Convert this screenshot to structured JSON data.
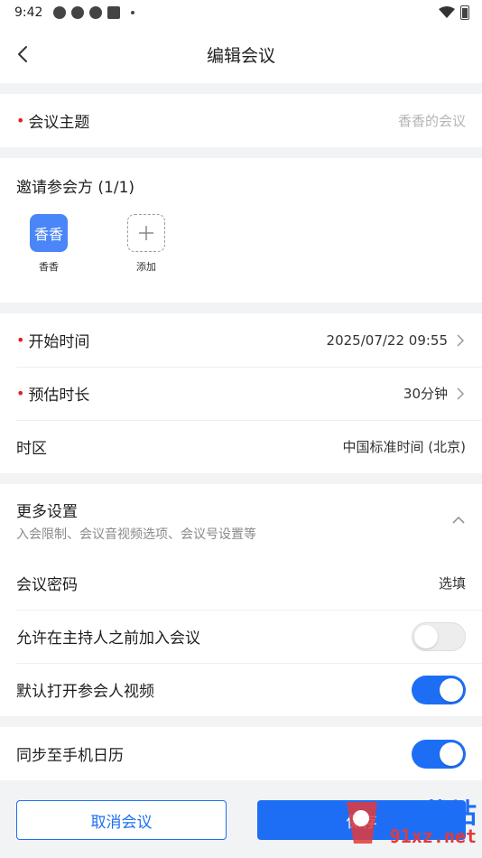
{
  "status_bar": {
    "time": "9:42"
  },
  "header": {
    "title": "编辑会议"
  },
  "topic": {
    "label": "会议主题",
    "placeholder": "香香的会议"
  },
  "invite": {
    "title": "邀请参会方 (1/1)",
    "participants": [
      {
        "avatar_text": "香香",
        "name": "香香"
      }
    ],
    "add_label": "添加"
  },
  "schedule": {
    "start_label": "开始时间",
    "start_value": "2025/07/22 09:55",
    "duration_label": "预估时长",
    "duration_value": "30分钟",
    "timezone_label": "时区",
    "timezone_value": "中国标准时间 (北京)"
  },
  "more": {
    "title": "更多设置",
    "subtitle": "入会限制、会议音视频选项、会议号设置等",
    "password_label": "会议密码",
    "password_value": "选填",
    "join_before_host_label": "允许在主持人之前加入会议",
    "join_before_host": false,
    "auto_video_label": "默认打开参会人视频",
    "auto_video": true
  },
  "sync": {
    "label": "同步至手机日历",
    "enabled": true
  },
  "actions": {
    "cancel_label": "取消会议",
    "save_label": "保存"
  },
  "watermark": {
    "line1": "下载站",
    "line2": "91xz.net"
  },
  "colors": {
    "accent": "#1e6ef5",
    "required": "#e02020",
    "avatar": "#4a86f7"
  }
}
